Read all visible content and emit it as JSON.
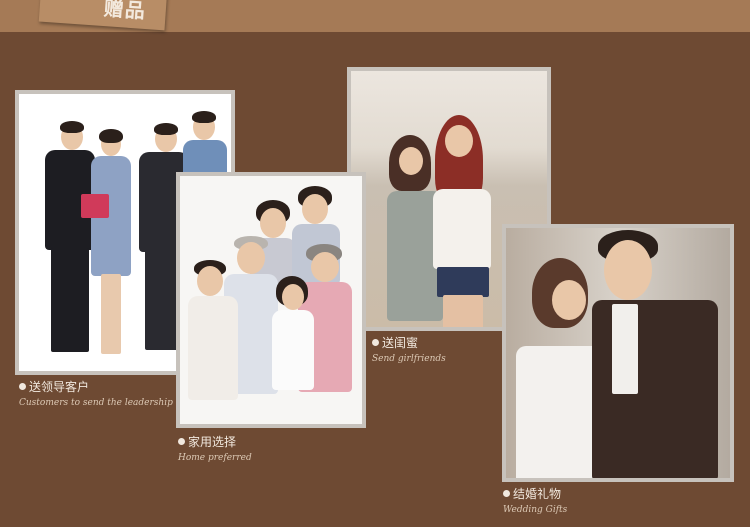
{
  "header": {
    "title_fragment": "赠品"
  },
  "cards": [
    {
      "zh": "送领导客户",
      "en": "Customers to send the leadership"
    },
    {
      "zh": "家用选择",
      "en": "Home preferred"
    },
    {
      "zh": "送闺蜜",
      "en": "Send girlfriends"
    },
    {
      "zh": "结婚礼物",
      "en": "Wedding Gifts"
    }
  ]
}
